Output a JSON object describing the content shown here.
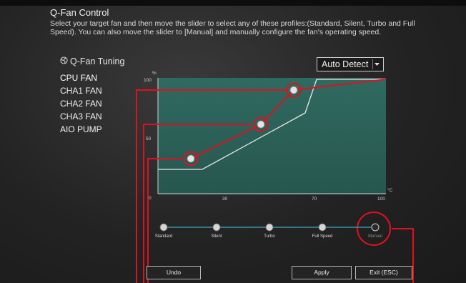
{
  "header": {
    "title": "Q-Fan Control",
    "description": "Select your target fan and then move the slider to select any of these profiles:(Standard, Silent, Turbo and Full Speed). You can also move the slider to [Manual] and manually configure the fan's operating speed."
  },
  "sidebar": {
    "heading": "Q-Fan Tuning",
    "fans": [
      {
        "label": "CPU FAN"
      },
      {
        "label": "CHA1 FAN"
      },
      {
        "label": "CHA2 FAN"
      },
      {
        "label": "CHA3 FAN"
      },
      {
        "label": "AIO PUMP"
      }
    ]
  },
  "source_select": {
    "value": "Auto Detect"
  },
  "chart": {
    "y_unit": "%",
    "x_unit": "°C",
    "y_ticks": [
      "100",
      "50",
      "0"
    ],
    "x_ticks": [
      "30",
      "70",
      "100"
    ]
  },
  "profiles": {
    "items": [
      {
        "label": "Standard"
      },
      {
        "label": "Silent"
      },
      {
        "label": "Turbo"
      },
      {
        "label": "Full Speed"
      },
      {
        "label": "Manual"
      }
    ],
    "selected": "Manual"
  },
  "buttons": {
    "undo": "Undo",
    "apply": "Apply",
    "exit": "Exit (ESC)"
  },
  "colors": {
    "chart_fill": "#2d5e56",
    "highlight": "#e01020",
    "curve": "#e8e8e8",
    "accent": "#3fa6c8"
  }
}
